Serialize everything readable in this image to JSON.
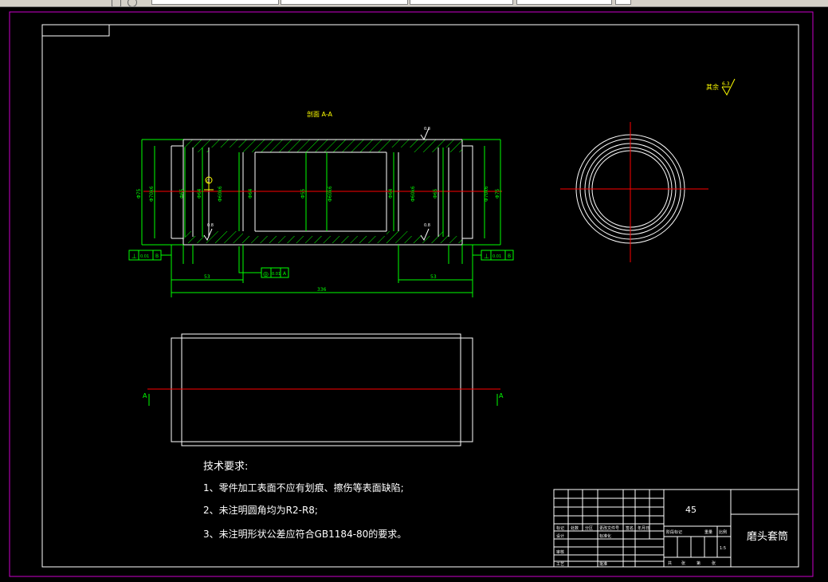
{
  "toolbar": {
    "fields": [
      "",
      "",
      "",
      "",
      ""
    ]
  },
  "drawing": {
    "section_label": "剖面 A-A",
    "roughness_note": "其余",
    "roughness_value": "6.3",
    "view_marker_left": "A",
    "view_marker_right": "A",
    "dimensions": {
      "overall_length": "336",
      "left_offset": "53",
      "right_offset": "53",
      "outer_dia": "Φ75",
      "bore_dia_left": "Φ70k6",
      "inner_dia_left": "Φ65",
      "step_dia_left": "Φ64",
      "center_bore": "Φ55",
      "center_mark": "Φ60k6",
      "step_dia_right": "Φ64",
      "inner_dia_right": "Φ65",
      "bore_dia_right": "Φ70k6",
      "outer_dia_right": "Φ75",
      "roughness_a": "0.8",
      "roughness_b": "0.8",
      "roughness_c": "0.8"
    },
    "tolerance_frames": {
      "left": {
        "symbol": "⊥",
        "value": "0.01",
        "datum": "B"
      },
      "center": {
        "symbol": "◎",
        "value": "0.01",
        "datum": "A"
      },
      "right": {
        "symbol": "⊥",
        "value": "0.01",
        "datum": "B"
      }
    },
    "datum_label": "C",
    "colors": {
      "outline": "#ffffff",
      "dimension": "#00ff00",
      "centerline": "#ff0000",
      "frame": "#ffffff",
      "border": "#cc00cc",
      "accent": "#ffff00"
    }
  },
  "tech_requirements": {
    "title": "技术要求:",
    "items": [
      "1、零件加工表面不应有划痕、擦伤等表面缺陷;",
      "2、未注明圆角均为R2-R8;",
      "3、未注明形状公差应符合GB1184-80的要求。"
    ]
  },
  "title_block": {
    "material": "45",
    "part_name": "磨头套筒",
    "headers": [
      "标记",
      "处数",
      "分区",
      "更改文件号",
      "签名",
      "年月日"
    ],
    "roles": [
      "设计",
      "审核",
      "工艺"
    ],
    "mid_labels": [
      "标准化",
      "",
      "",
      "批准"
    ],
    "stage_labels": [
      "阶段标记",
      "重量",
      "比例"
    ],
    "scale": "1:5",
    "sheet_labels": [
      "共",
      "张",
      "第",
      "张"
    ]
  }
}
